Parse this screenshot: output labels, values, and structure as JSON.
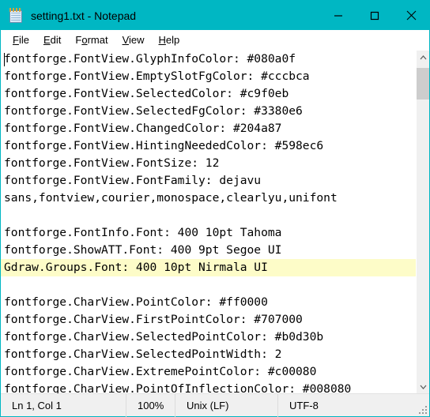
{
  "window": {
    "title": "setting1.txt - Notepad",
    "icon": "notepad-icon",
    "titlebar_color": "#00b7c3",
    "controls": {
      "minimize": "Minimize",
      "maximize": "Maximize",
      "close": "Close"
    }
  },
  "menubar": {
    "items": [
      {
        "accel": "F",
        "rest": "ile"
      },
      {
        "accel": "E",
        "rest": "dit"
      },
      {
        "pre": "F",
        "accel": "o",
        "rest": "rmat"
      },
      {
        "accel": "V",
        "rest": "iew"
      },
      {
        "accel": "H",
        "rest": "elp"
      }
    ]
  },
  "editor": {
    "highlight_color": "#fdfcc8",
    "lines": [
      {
        "text": "fontforge.FontView.GlyphInfoColor: #080a0f",
        "highlight": false
      },
      {
        "text": "fontforge.FontView.EmptySlotFgColor: #cccbca",
        "highlight": false
      },
      {
        "text": "fontforge.FontView.SelectedColor: #c9f0eb",
        "highlight": false
      },
      {
        "text": "fontforge.FontView.SelectedFgColor: #3380e6",
        "highlight": false
      },
      {
        "text": "fontforge.FontView.ChangedColor: #204a87",
        "highlight": false
      },
      {
        "text": "fontforge.FontView.HintingNeededColor: #598ec6",
        "highlight": false
      },
      {
        "text": "fontforge.FontView.FontSize: 12",
        "highlight": false
      },
      {
        "text": "fontforge.FontView.FontFamily: dejavu",
        "highlight": false
      },
      {
        "text": "sans,fontview,courier,monospace,clearlyu,unifont",
        "highlight": false
      },
      {
        "text": "",
        "highlight": false
      },
      {
        "text": "fontforge.FontInfo.Font: 400 10pt Tahoma",
        "highlight": false
      },
      {
        "text": "fontforge.ShowATT.Font: 400 9pt Segoe UI",
        "highlight": false
      },
      {
        "text": "Gdraw.Groups.Font: 400 10pt Nirmala UI",
        "highlight": true
      },
      {
        "text": "",
        "highlight": false
      },
      {
        "text": "fontforge.CharView.PointColor: #ff0000",
        "highlight": false
      },
      {
        "text": "fontforge.CharView.FirstPointColor: #707000",
        "highlight": false
      },
      {
        "text": "fontforge.CharView.SelectedPointColor: #b0d30b",
        "highlight": false
      },
      {
        "text": "fontforge.CharView.SelectedPointWidth: 2",
        "highlight": false
      },
      {
        "text": "fontforge.CharView.ExtremePointColor: #c00080",
        "highlight": false
      },
      {
        "text": "fontforge.CharView.PointOfInflectionColor: #008080",
        "highlight": false
      }
    ]
  },
  "scrollbar": {
    "up_arrow": "scroll-up-icon",
    "down_arrow": "scroll-down-icon"
  },
  "statusbar": {
    "position": "Ln 1, Col 1",
    "zoom": "100%",
    "line_ending": "Unix (LF)",
    "encoding": "UTF-8"
  }
}
